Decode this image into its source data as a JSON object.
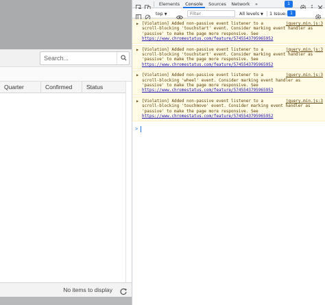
{
  "page": {
    "search": {
      "placeholder": "Search..."
    },
    "columns": [
      "Quarter",
      "Confirmed",
      "Status"
    ],
    "footer": {
      "empty_text": "No items to display"
    }
  },
  "devtools": {
    "tabs": [
      "Elements",
      "Console",
      "Sources",
      "Network"
    ],
    "more_tabs": "»",
    "issues_badge": "1",
    "console_bar": {
      "context": "top",
      "filter_placeholder": "Filter",
      "levels": "All levels",
      "issue_text": "1 Issue:",
      "issue_chip": "1"
    },
    "messages": [
      {
        "text": "[Violation] Added non-passive event listener to a scroll-blocking 'touchstart' event. Consider marking event handler as 'passive' to make the page more responsive. See ",
        "link": "https://www.chromestatus.com/feature/5745543795965952",
        "source": "jquery.min.js:3"
      },
      {
        "text": "[Violation] Added non-passive event listener to a scroll-blocking 'touchstart' event. Consider marking event handler as 'passive' to make the page more responsive. See ",
        "link": "https://www.chromestatus.com/feature/5745543795965952",
        "source": "jquery.min.js:3"
      },
      {
        "text": "[Violation] Added non-passive event listener to a scroll-blocking 'wheel' event. Consider marking event handler as 'passive' to make the page more responsive. See ",
        "link": "https://www.chromestatus.com/feature/5745543795965952",
        "source": "jquery.min.js:3"
      },
      {
        "text": "[Violation] Added non-passive event listener to a scroll-blocking 'touchmove' event. Consider marking event handler as 'passive' to make the page more responsive. See ",
        "link": "https://www.chromestatus.com/feature/5745543795965952",
        "source": "jquery.min.js:3"
      }
    ],
    "prompt_symbol": ">"
  },
  "colors": {
    "accent": "#1a73e8",
    "warning_bg": "#fffbe5",
    "warning_text": "#5c3b00"
  }
}
